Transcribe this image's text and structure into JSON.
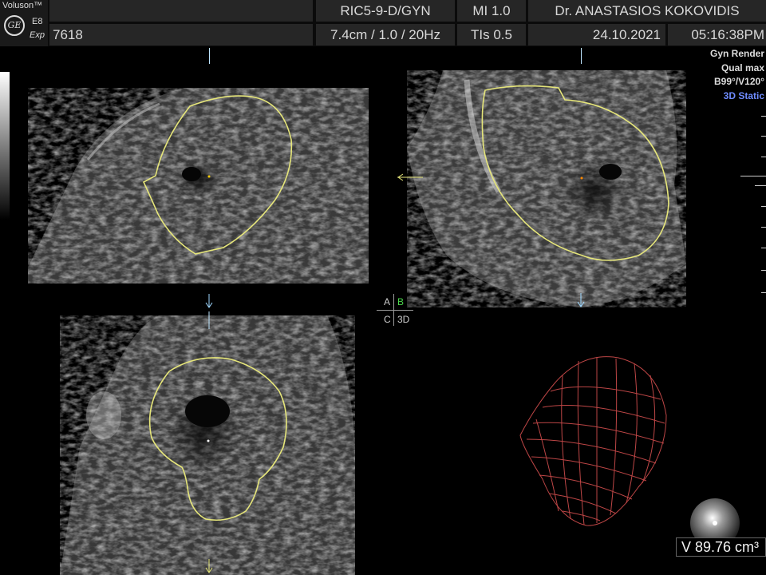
{
  "header": {
    "brand": "Voluson™",
    "model_line1": "E8",
    "model_line2": "Exp",
    "logo_text": "GE",
    "patient_id": "7618",
    "probe": "RIC5-9-D/GYN",
    "params": "7.4cm / 1.0 / 20Hz",
    "mi": "MI  1.0",
    "tis": "TIs  0.5",
    "doctor": "Dr. ANASTASIOS KOKOVIDIS",
    "date": "24.10.2021",
    "time": "05:16:38PM"
  },
  "render_info": {
    "line1": "Gyn Render",
    "line2": "Qual max",
    "line3": "B99°/V120°",
    "mode": "3D Static"
  },
  "plane_labels": {
    "a": "A",
    "b": "B",
    "c": "C",
    "d": "3D"
  },
  "volume": {
    "text": "V 89.76 cm³"
  },
  "colors": {
    "contour": "#e6e67a",
    "mesh": "#c84a4a",
    "plane_b": "#4cd64c",
    "mode_text": "#6f8cff"
  }
}
